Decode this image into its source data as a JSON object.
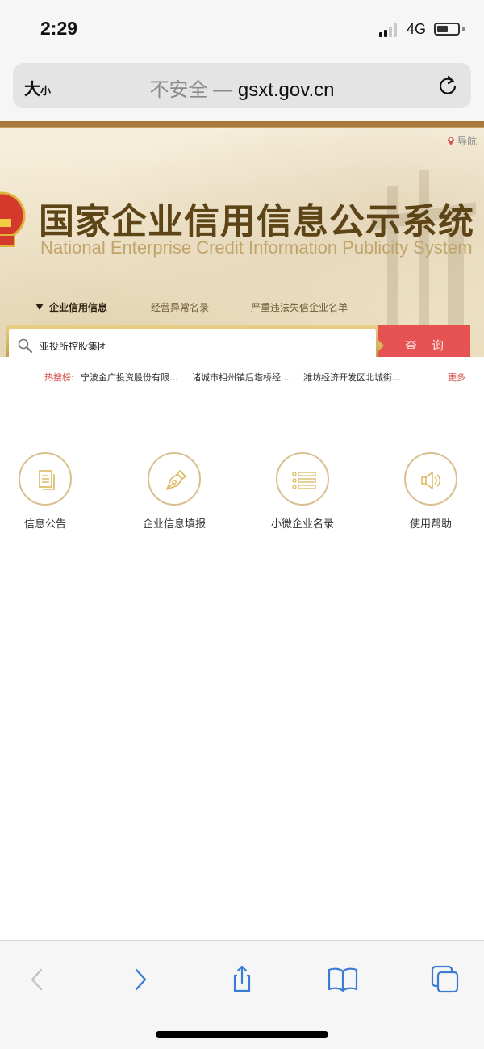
{
  "status_bar": {
    "time": "2:29",
    "network": "4G",
    "signal_bars_active": 2,
    "signal_bars_total": 4,
    "battery_level": 0.55
  },
  "browser": {
    "text_size_label_big": "大",
    "text_size_label_small": "小",
    "url_security_label": "不安全 — ",
    "url_domain": "gsxt.gov.cn",
    "reload_icon": "reload-icon"
  },
  "site": {
    "nav_link": "导航",
    "title_cn": "国家企业信用信息公示系统",
    "title_en": "National Enterprise Credit Information Publicity System",
    "category_tabs": [
      {
        "label": "企业信用信息",
        "active": true
      },
      {
        "label": "经营异常名录",
        "active": false
      },
      {
        "label": "严重违法失信企业名单",
        "active": false
      }
    ],
    "search": {
      "value": "亚投所控股集团",
      "button_label": "查询"
    },
    "hot_search": {
      "label": "热搜榜:",
      "items": [
        "宁波金广投资股份有限...",
        "诸城市相州镇后塔桥经...",
        "潍坊经济开发区北城街..."
      ],
      "more": "更多"
    },
    "quick_links": [
      {
        "label": "信息公告",
        "icon": "document-icon"
      },
      {
        "label": "企业信息填报",
        "icon": "pen-nib-icon"
      },
      {
        "label": "小微企业名录",
        "icon": "list-icon"
      },
      {
        "label": "使用帮助",
        "icon": "speaker-icon"
      }
    ]
  },
  "colors": {
    "accent_gold": "#a8793a",
    "title_brown": "#5c4416",
    "search_red": "#e65152",
    "hot_red": "#d8524d",
    "ios_blue": "#3a7bd5",
    "icon_gold": "#d9c08f"
  },
  "toolbar": {
    "back_enabled": false,
    "forward_enabled": true
  }
}
